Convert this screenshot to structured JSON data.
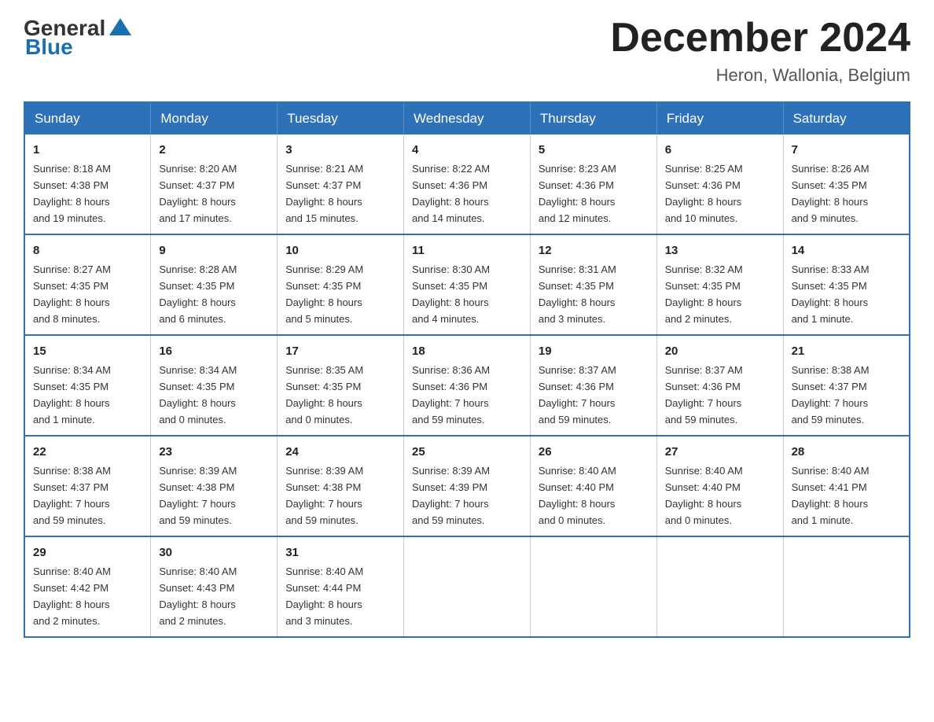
{
  "logo": {
    "text_general": "General",
    "text_blue": "Blue"
  },
  "title": "December 2024",
  "subtitle": "Heron, Wallonia, Belgium",
  "days_of_week": [
    "Sunday",
    "Monday",
    "Tuesday",
    "Wednesday",
    "Thursday",
    "Friday",
    "Saturday"
  ],
  "weeks": [
    [
      {
        "day": "1",
        "sunrise": "8:18 AM",
        "sunset": "4:38 PM",
        "daylight": "8 hours and 19 minutes."
      },
      {
        "day": "2",
        "sunrise": "8:20 AM",
        "sunset": "4:37 PM",
        "daylight": "8 hours and 17 minutes."
      },
      {
        "day": "3",
        "sunrise": "8:21 AM",
        "sunset": "4:37 PM",
        "daylight": "8 hours and 15 minutes."
      },
      {
        "day": "4",
        "sunrise": "8:22 AM",
        "sunset": "4:36 PM",
        "daylight": "8 hours and 14 minutes."
      },
      {
        "day": "5",
        "sunrise": "8:23 AM",
        "sunset": "4:36 PM",
        "daylight": "8 hours and 12 minutes."
      },
      {
        "day": "6",
        "sunrise": "8:25 AM",
        "sunset": "4:36 PM",
        "daylight": "8 hours and 10 minutes."
      },
      {
        "day": "7",
        "sunrise": "8:26 AM",
        "sunset": "4:35 PM",
        "daylight": "8 hours and 9 minutes."
      }
    ],
    [
      {
        "day": "8",
        "sunrise": "8:27 AM",
        "sunset": "4:35 PM",
        "daylight": "8 hours and 8 minutes."
      },
      {
        "day": "9",
        "sunrise": "8:28 AM",
        "sunset": "4:35 PM",
        "daylight": "8 hours and 6 minutes."
      },
      {
        "day": "10",
        "sunrise": "8:29 AM",
        "sunset": "4:35 PM",
        "daylight": "8 hours and 5 minutes."
      },
      {
        "day": "11",
        "sunrise": "8:30 AM",
        "sunset": "4:35 PM",
        "daylight": "8 hours and 4 minutes."
      },
      {
        "day": "12",
        "sunrise": "8:31 AM",
        "sunset": "4:35 PM",
        "daylight": "8 hours and 3 minutes."
      },
      {
        "day": "13",
        "sunrise": "8:32 AM",
        "sunset": "4:35 PM",
        "daylight": "8 hours and 2 minutes."
      },
      {
        "day": "14",
        "sunrise": "8:33 AM",
        "sunset": "4:35 PM",
        "daylight": "8 hours and 1 minute."
      }
    ],
    [
      {
        "day": "15",
        "sunrise": "8:34 AM",
        "sunset": "4:35 PM",
        "daylight": "8 hours and 1 minute."
      },
      {
        "day": "16",
        "sunrise": "8:34 AM",
        "sunset": "4:35 PM",
        "daylight": "8 hours and 0 minutes."
      },
      {
        "day": "17",
        "sunrise": "8:35 AM",
        "sunset": "4:35 PM",
        "daylight": "8 hours and 0 minutes."
      },
      {
        "day": "18",
        "sunrise": "8:36 AM",
        "sunset": "4:36 PM",
        "daylight": "7 hours and 59 minutes."
      },
      {
        "day": "19",
        "sunrise": "8:37 AM",
        "sunset": "4:36 PM",
        "daylight": "7 hours and 59 minutes."
      },
      {
        "day": "20",
        "sunrise": "8:37 AM",
        "sunset": "4:36 PM",
        "daylight": "7 hours and 59 minutes."
      },
      {
        "day": "21",
        "sunrise": "8:38 AM",
        "sunset": "4:37 PM",
        "daylight": "7 hours and 59 minutes."
      }
    ],
    [
      {
        "day": "22",
        "sunrise": "8:38 AM",
        "sunset": "4:37 PM",
        "daylight": "7 hours and 59 minutes."
      },
      {
        "day": "23",
        "sunrise": "8:39 AM",
        "sunset": "4:38 PM",
        "daylight": "7 hours and 59 minutes."
      },
      {
        "day": "24",
        "sunrise": "8:39 AM",
        "sunset": "4:38 PM",
        "daylight": "7 hours and 59 minutes."
      },
      {
        "day": "25",
        "sunrise": "8:39 AM",
        "sunset": "4:39 PM",
        "daylight": "7 hours and 59 minutes."
      },
      {
        "day": "26",
        "sunrise": "8:40 AM",
        "sunset": "4:40 PM",
        "daylight": "8 hours and 0 minutes."
      },
      {
        "day": "27",
        "sunrise": "8:40 AM",
        "sunset": "4:40 PM",
        "daylight": "8 hours and 0 minutes."
      },
      {
        "day": "28",
        "sunrise": "8:40 AM",
        "sunset": "4:41 PM",
        "daylight": "8 hours and 1 minute."
      }
    ],
    [
      {
        "day": "29",
        "sunrise": "8:40 AM",
        "sunset": "4:42 PM",
        "daylight": "8 hours and 2 minutes."
      },
      {
        "day": "30",
        "sunrise": "8:40 AM",
        "sunset": "4:43 PM",
        "daylight": "8 hours and 2 minutes."
      },
      {
        "day": "31",
        "sunrise": "8:40 AM",
        "sunset": "4:44 PM",
        "daylight": "8 hours and 3 minutes."
      },
      null,
      null,
      null,
      null
    ]
  ],
  "labels": {
    "sunrise": "Sunrise:",
    "sunset": "Sunset:",
    "daylight": "Daylight:"
  }
}
